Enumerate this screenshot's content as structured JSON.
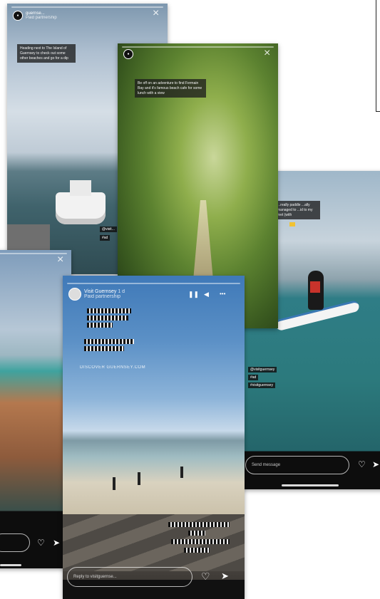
{
  "stories": {
    "boat": {
      "username": "guernse...",
      "subtitle": "Paid partnership",
      "caption": "Heading next to The Island of Guernsey to check out some other beaches and go for a dip",
      "tag1": "@visit...",
      "tag2": "#ad"
    },
    "path": {
      "caption": "Be off on an adventure to find Fermain Bay and it's famous beach cafe for some lunch with a view"
    },
    "paddle": {
      "caption": "...really paddle ...ally managed to ...id to my feet (with",
      "tag1": "@visitguernsey",
      "tag2": "#ad",
      "tag3": "#visitguernsey",
      "reply": "Send message"
    },
    "beach": {
      "username": "Visit Guernsey",
      "time": "1 d",
      "subtitle": "Paid partnership",
      "link": "DISCOVER GUERNSEY.COM",
      "reply": "Reply to visitguernse..."
    }
  },
  "icons": {
    "close": "×",
    "heart": "♡",
    "send": "➤",
    "pause": "❚❚",
    "sound": "◀",
    "more": "•••"
  },
  "colors": {
    "caption_bg": "#1e1e1e",
    "accent": "#ffffff"
  }
}
